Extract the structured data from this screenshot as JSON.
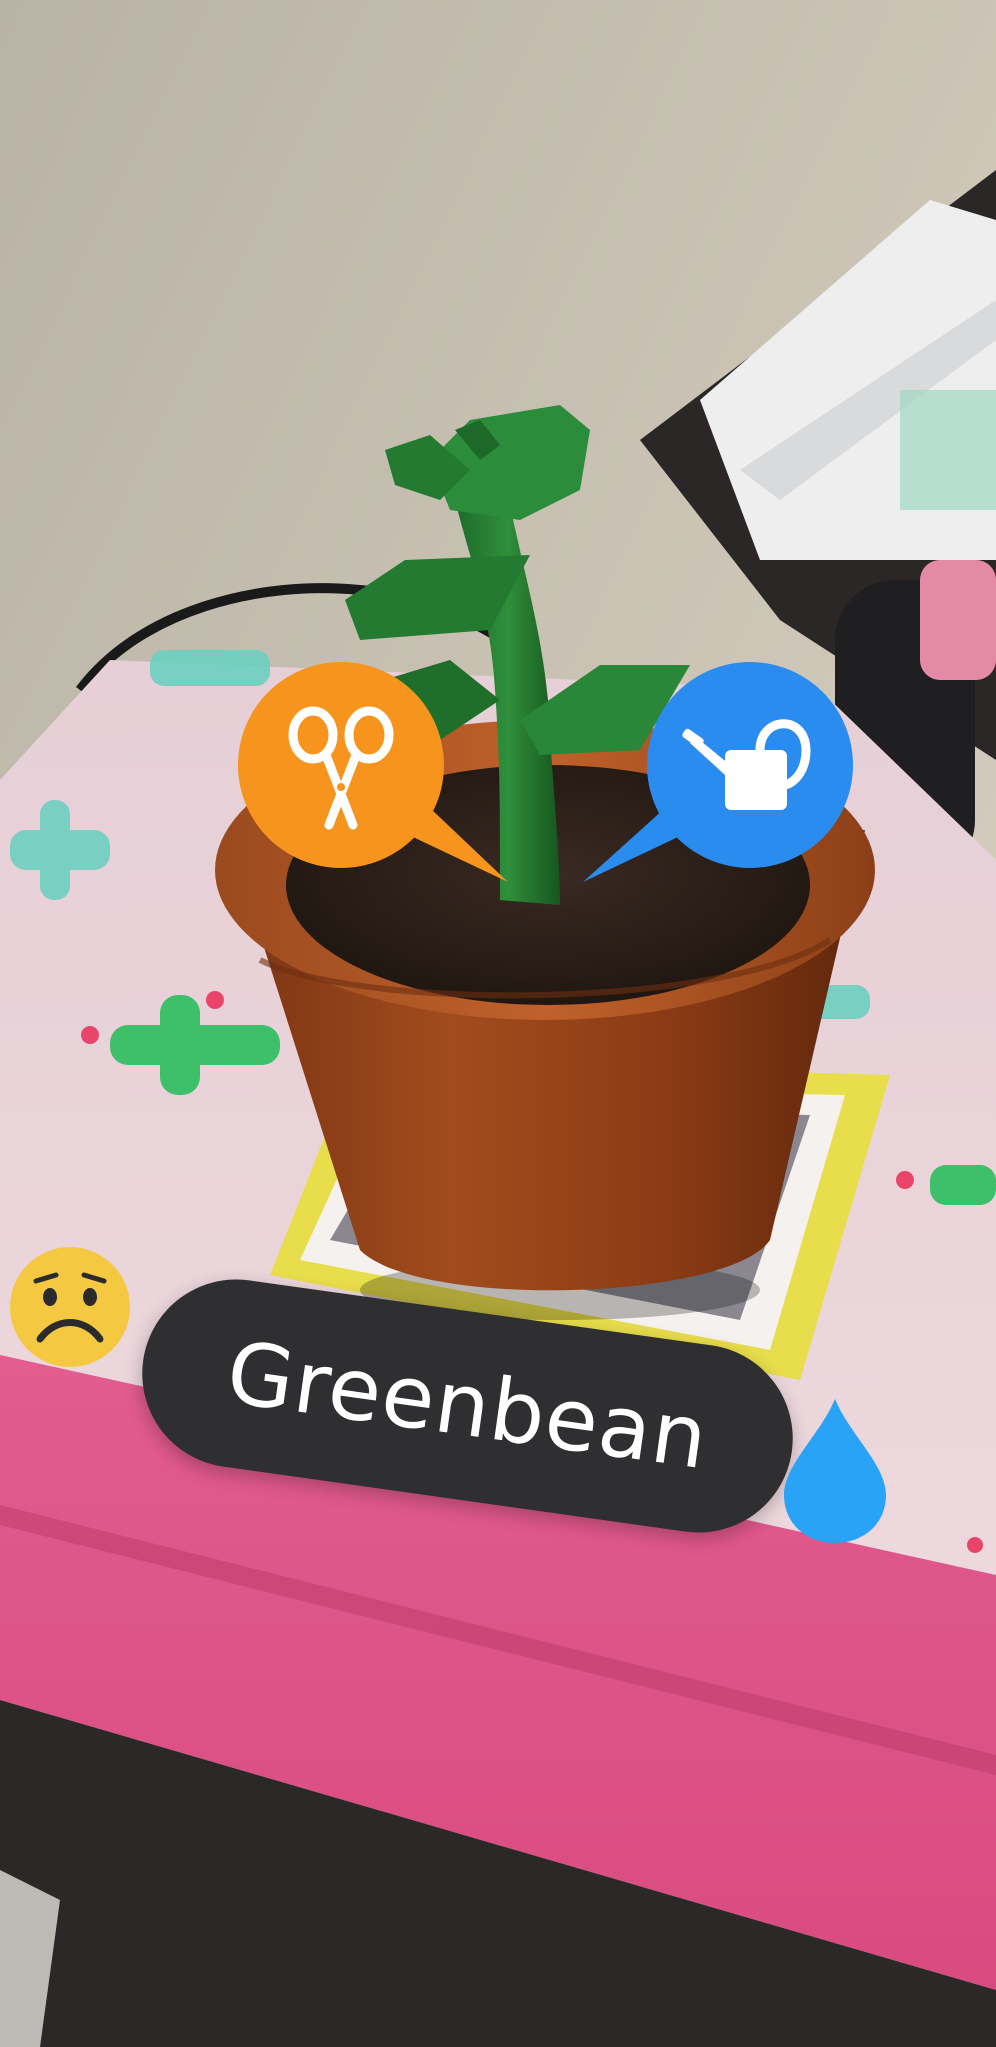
{
  "plant": {
    "name": "Greenbean"
  },
  "actions": {
    "prune": {
      "icon": "scissors-icon",
      "color": "#F7941D"
    },
    "water": {
      "icon": "watering-can-icon",
      "color": "#2B8CF0"
    }
  },
  "status": {
    "mood": {
      "icon": "sad-face-icon",
      "color": "#F5C842"
    },
    "thirst": {
      "icon": "water-drop-icon",
      "color": "#29A3F5"
    }
  }
}
